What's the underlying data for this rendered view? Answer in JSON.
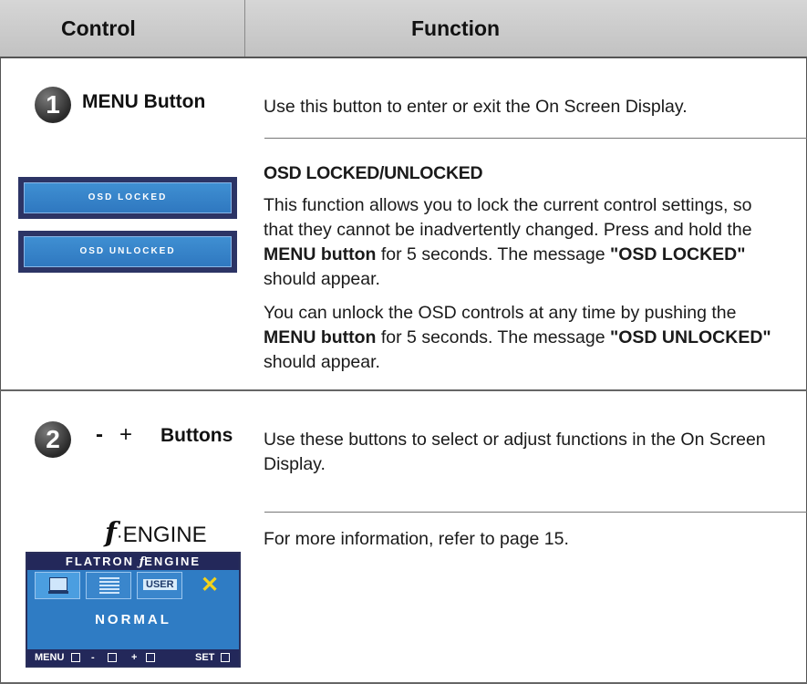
{
  "header": {
    "control": "Control",
    "function": "Function"
  },
  "row1": {
    "number": "1",
    "control": "MENU Button",
    "description": "Use this button to enter or exit the On Screen Display.",
    "osd_locked_label": "OSD LOCKED",
    "osd_unlocked_label": "OSD UNLOCKED",
    "section_title": "OSD LOCKED/UNLOCKED",
    "p1_a": "This function allows you to lock the current control settings, so that they cannot be inadvertently changed. Press and hold the ",
    "p1_b": "MENU button",
    "p1_c": " for 5 seconds. The message ",
    "p1_d": "\"OSD LOCKED\"",
    "p1_e": " should appear.",
    "p2_a": "You can unlock the OSD controls at any time by pushing the ",
    "p2_b": "MENU button",
    "p2_c": " for 5 seconds. The message ",
    "p2_d": "\"OSD UNLOCKED\"",
    "p2_e": " should appear."
  },
  "row2": {
    "number": "2",
    "minus": "-",
    "plus": "+",
    "control": "Buttons",
    "description": "Use these buttons to select or adjust functions in the On Screen Display.",
    "fengine_logo_text": "ENGINE",
    "fengine_info": "For more information, refer to page 15.",
    "panel": {
      "title": "FLATRON",
      "title_engine": "ENGINE",
      "user_label": "USER",
      "mode": "NORMAL",
      "bottom": {
        "menu": "MENU",
        "minus": "-",
        "plus": "+",
        "set": "SET"
      }
    }
  },
  "colors": {
    "header_bg": "#c8c8c8",
    "osd_blue": "#2f7cc4",
    "osd_border": "#2c3465"
  }
}
